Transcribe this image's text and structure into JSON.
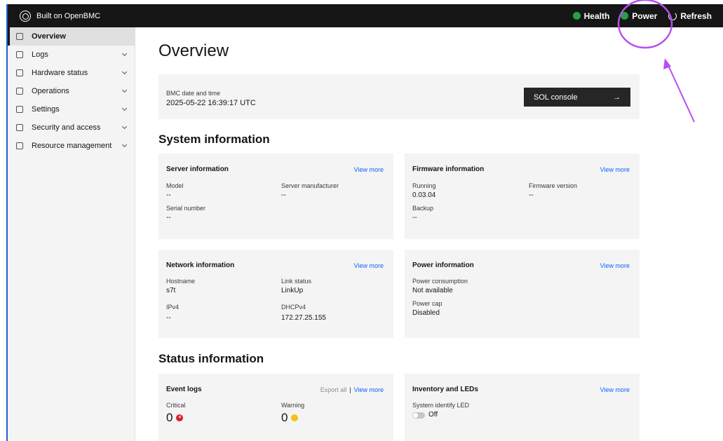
{
  "topbar": {
    "brand": "Built on OpenBMC",
    "health": "Health",
    "power": "Power",
    "refresh": "Refresh"
  },
  "sidebar": {
    "items": [
      {
        "label": "Overview",
        "icon": "dashboard-icon"
      },
      {
        "label": "Logs",
        "icon": "logs-icon"
      },
      {
        "label": "Hardware status",
        "icon": "hardware-icon"
      },
      {
        "label": "Operations",
        "icon": "operations-icon"
      },
      {
        "label": "Settings",
        "icon": "settings-icon"
      },
      {
        "label": "Security and access",
        "icon": "security-icon"
      },
      {
        "label": "Resource management",
        "icon": "resource-icon"
      }
    ]
  },
  "main": {
    "title": "Overview",
    "bmc": {
      "label": "BMC date and time",
      "value": "2025-05-22 16:39:17 UTC",
      "sol_label": "SOL console",
      "sol_arrow": "→"
    },
    "system_title": "System information",
    "server": {
      "title": "Server information",
      "link": "View more",
      "model_label": "Model",
      "model_value": "--",
      "manufacturer_label": "Server manufacturer",
      "manufacturer_value": "--",
      "serial_label": "Serial number",
      "serial_value": "--"
    },
    "firmware": {
      "title": "Firmware information",
      "link": "View more",
      "running_label": "Running",
      "running_value": "0.03.04",
      "version_label": "Firmware version",
      "version_value": "--",
      "backup_label": "Backup",
      "backup_value": "--"
    },
    "network": {
      "title": "Network information",
      "link": "View more",
      "hostname_label": "Hostname",
      "hostname_value": "s7t",
      "link_status_label": "Link status",
      "link_status_value": "LinkUp",
      "ipv4_label": "IPv4",
      "ipv4_value": "--",
      "dhcp_label": "DHCPv4",
      "dhcp_value": "172.27.25.155"
    },
    "power": {
      "title": "Power information",
      "link": "View more",
      "consumption_label": "Power consumption",
      "consumption_value": "Not available",
      "cap_label": "Power cap",
      "cap_value": "Disabled"
    },
    "status_title": "Status information",
    "events": {
      "title": "Event logs",
      "export": "Export all",
      "link": "View more",
      "critical_label": "Critical",
      "critical_value": "0",
      "warning_label": "Warning",
      "warning_value": "0"
    },
    "inventory": {
      "title": "Inventory and LEDs",
      "link": "View more",
      "led_label": "System identify LED",
      "led_value": "Off"
    }
  },
  "colors": {
    "topbar": "#161616",
    "sidebar": "#f4f4f4",
    "link": "#0f62fe",
    "ok": "#24a148",
    "critical": "#da1e28",
    "warning": "#f1c21b",
    "annotation": "#b84ef0"
  }
}
